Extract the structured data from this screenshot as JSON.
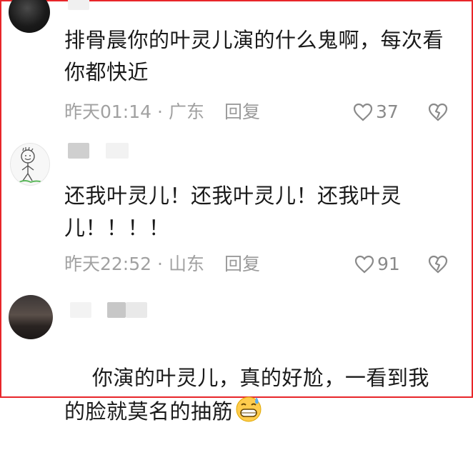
{
  "comments": [
    {
      "text": "排骨晨你的叶灵儿演的什么鬼啊，每次看你都快近",
      "time": "昨天01:14",
      "location": "广东",
      "reply_label": "回复",
      "likes": "37"
    },
    {
      "text": "还我叶灵儿！还我叶灵儿！还我叶灵儿！！！！",
      "time": "昨天22:52",
      "location": "山东",
      "reply_label": "回复",
      "likes": "91"
    },
    {
      "text": "你演的叶灵儿，真的好尬，一看到我的脸就莫名的抽筋",
      "emoji": "grinning-sweat-emoji"
    }
  ],
  "meta_separator": "·",
  "colors": {
    "frame": "#e8262a",
    "text": "#1a1a1a",
    "meta": "#a1a1a1"
  },
  "icons": {
    "like": "heart-outline-icon",
    "dislike": "broken-heart-icon"
  }
}
